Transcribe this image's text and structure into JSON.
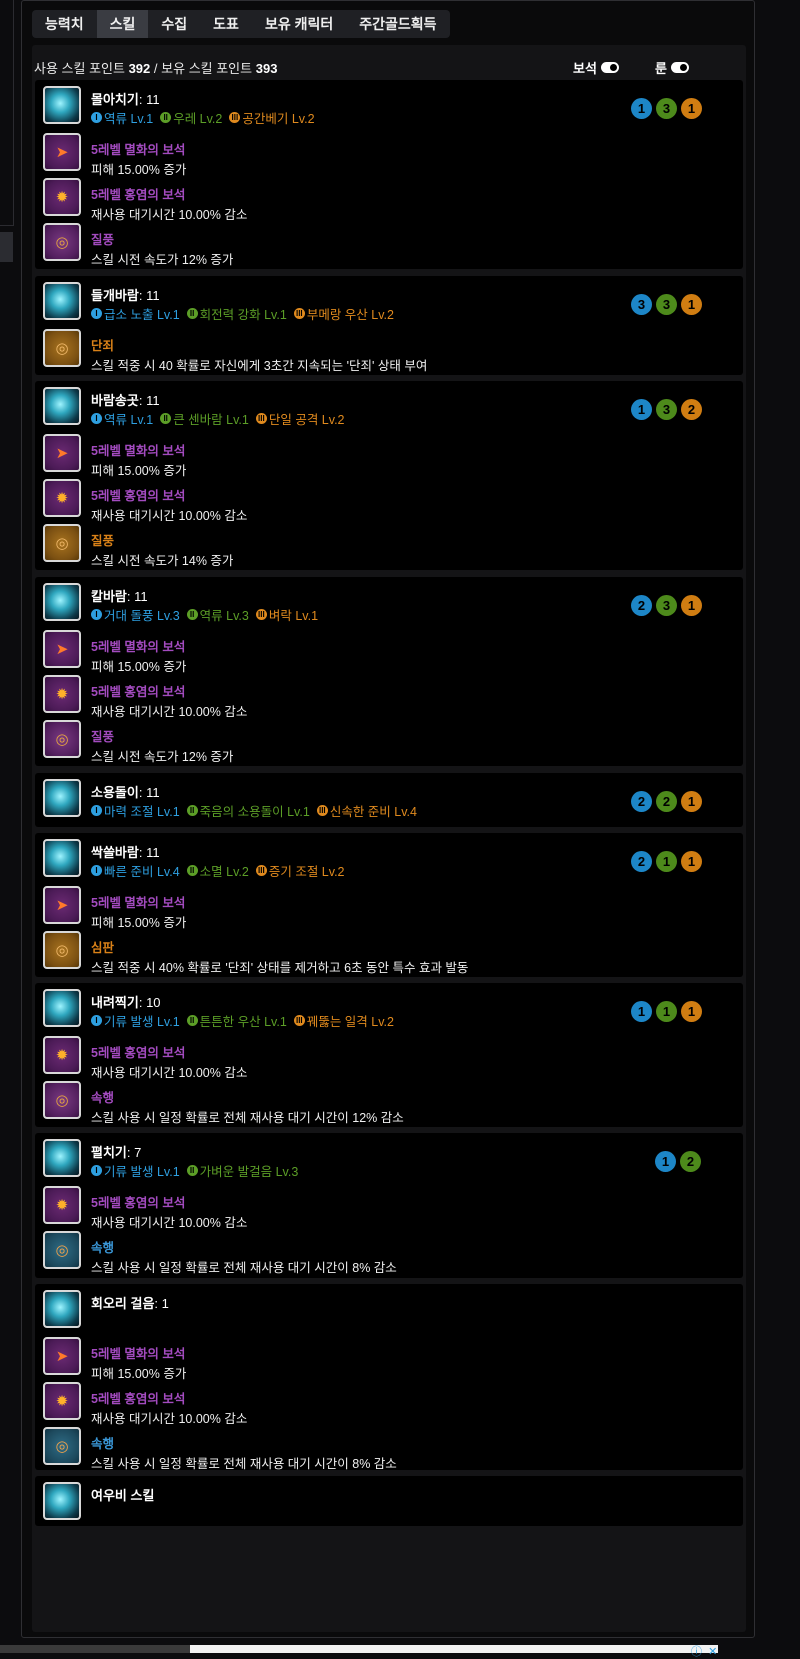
{
  "tabs": [
    "능력치",
    "스킬",
    "수집",
    "도표",
    "보유 캐릭터",
    "주간골드획득"
  ],
  "active_tab": 1,
  "points": {
    "used_label": "사용 스킬 포인트",
    "used": "392",
    "sep": "/",
    "owned_label": "보유 스킬 포인트",
    "owned": "393"
  },
  "toggles": {
    "gem": "보석",
    "rune": "룬"
  },
  "skills": [
    {
      "name": "몰아치기",
      "level": ": 11",
      "tripods": [
        {
          "tier": "I",
          "label": "역류 Lv.1"
        },
        {
          "tier": "II",
          "label": "우레 Lv.2"
        },
        {
          "tier": "III",
          "label": "공간베기 Lv.2"
        }
      ],
      "circles": [
        "1",
        "3",
        "1"
      ],
      "items": [
        {
          "title": "5레벨 멸화의 보석",
          "desc": "피해 15.00% 증가",
          "color": "purple",
          "icon": "gem-red"
        },
        {
          "title": "5레벨 홍염의 보석",
          "desc": "재사용 대기시간 10.00% 감소",
          "color": "purple",
          "icon": "gem-org"
        },
        {
          "title": "질풍",
          "desc": "스킬 시전 속도가 12% 증가",
          "color": "purple",
          "icon": "rune-purple"
        }
      ]
    },
    {
      "name": "들개바람",
      "level": ": 11",
      "tripods": [
        {
          "tier": "I",
          "label": "급소 노출 Lv.1"
        },
        {
          "tier": "II",
          "label": "회전력 강화 Lv.1"
        },
        {
          "tier": "III",
          "label": "부메랑 우산 Lv.2"
        }
      ],
      "circles": [
        "3",
        "3",
        "1"
      ],
      "items": [
        {
          "title": "단죄",
          "desc": "스킬 적중 시 40 확률로 자신에게 3초간 지속되는 '단죄' 상태 부여",
          "color": "orange",
          "icon": "rune-orange"
        }
      ]
    },
    {
      "name": "바람송곳",
      "level": ": 11",
      "tripods": [
        {
          "tier": "I",
          "label": "역류 Lv.1"
        },
        {
          "tier": "II",
          "label": "큰 센바람 Lv.1"
        },
        {
          "tier": "III",
          "label": "단일 공격 Lv.2"
        }
      ],
      "circles": [
        "1",
        "3",
        "2"
      ],
      "items": [
        {
          "title": "5레벨 멸화의 보석",
          "desc": "피해 15.00% 증가",
          "color": "purple",
          "icon": "gem-red"
        },
        {
          "title": "5레벨 홍염의 보석",
          "desc": "재사용 대기시간 10.00% 감소",
          "color": "purple",
          "icon": "gem-org"
        },
        {
          "title": "질풍",
          "desc": "스킬 시전 속도가 14% 증가",
          "color": "orange",
          "icon": "rune-orange"
        }
      ]
    },
    {
      "name": "칼바람",
      "level": ": 11",
      "tripods": [
        {
          "tier": "I",
          "label": "거대 돌풍 Lv.3"
        },
        {
          "tier": "II",
          "label": "역류 Lv.3"
        },
        {
          "tier": "III",
          "label": "벼락 Lv.1"
        }
      ],
      "circles": [
        "2",
        "3",
        "1"
      ],
      "items": [
        {
          "title": "5레벨 멸화의 보석",
          "desc": "피해 15.00% 증가",
          "color": "purple",
          "icon": "gem-red"
        },
        {
          "title": "5레벨 홍염의 보석",
          "desc": "재사용 대기시간 10.00% 감소",
          "color": "purple",
          "icon": "gem-org"
        },
        {
          "title": "질풍",
          "desc": "스킬 시전 속도가 12% 증가",
          "color": "purple",
          "icon": "rune-purple"
        }
      ]
    },
    {
      "name": "소용돌이",
      "level": ": 11",
      "tripods": [
        {
          "tier": "I",
          "label": "마력 조절 Lv.1"
        },
        {
          "tier": "II",
          "label": "죽음의 소용돌이 Lv.1"
        },
        {
          "tier": "III",
          "label": "신속한 준비 Lv.4"
        }
      ],
      "circles": [
        "2",
        "2",
        "1"
      ],
      "items": []
    },
    {
      "name": "싹쓸바람",
      "level": ": 11",
      "tripods": [
        {
          "tier": "I",
          "label": "빠른 준비 Lv.4"
        },
        {
          "tier": "II",
          "label": "소멸 Lv.2"
        },
        {
          "tier": "III",
          "label": "증기 조절 Lv.2"
        }
      ],
      "circles": [
        "2",
        "1",
        "1"
      ],
      "items": [
        {
          "title": "5레벨 멸화의 보석",
          "desc": "피해 15.00% 증가",
          "color": "purple",
          "icon": "gem-red"
        },
        {
          "title": "심판",
          "desc": "스킬 적중 시 40% 확률로 '단죄' 상태를 제거하고 6초 동안 특수 효과 발동",
          "color": "orange",
          "icon": "rune-orange"
        }
      ]
    },
    {
      "name": "내려찍기",
      "level": ": 10",
      "tripods": [
        {
          "tier": "I",
          "label": "기류 발생 Lv.1"
        },
        {
          "tier": "II",
          "label": "튼튼한 우산 Lv.1"
        },
        {
          "tier": "III",
          "label": "꿰뚫는 일격 Lv.2"
        }
      ],
      "circles": [
        "1",
        "1",
        "1"
      ],
      "items": [
        {
          "title": "5레벨 홍염의 보석",
          "desc": "재사용 대기시간 10.00% 감소",
          "color": "purple",
          "icon": "gem-org"
        },
        {
          "title": "속행",
          "desc": "스킬 사용 시 일정 확률로 전체 재사용 대기 시간이 12% 감소",
          "color": "purple",
          "icon": "rune-purple"
        }
      ]
    },
    {
      "name": "펼치기",
      "level": ": 7",
      "tripods": [
        {
          "tier": "I",
          "label": "기류 발생 Lv.1"
        },
        {
          "tier": "II",
          "label": "가벼운 발걸음 Lv.3"
        }
      ],
      "circles": [
        "1",
        "2"
      ],
      "items": [
        {
          "title": "5레벨 홍염의 보석",
          "desc": "재사용 대기시간 10.00% 감소",
          "color": "purple",
          "icon": "gem-org"
        },
        {
          "title": "속행",
          "desc": "스킬 사용 시 일정 확률로 전체 재사용 대기 시간이 8% 감소",
          "color": "blue",
          "icon": "rune-blue"
        }
      ]
    },
    {
      "name": "회오리 걸음",
      "level": ": 1",
      "tripods": [],
      "circles": [],
      "items": [
        {
          "title": "5레벨 멸화의 보석",
          "desc": "피해 15.00% 증가",
          "color": "purple",
          "icon": "gem-red"
        },
        {
          "title": "5레벨 홍염의 보석",
          "desc": "재사용 대기시간 10.00% 감소",
          "color": "purple",
          "icon": "gem-org"
        },
        {
          "title": "속행",
          "desc": "스킬 사용 시 일정 확률로 전체 재사용 대기 시간이 8% 감소",
          "color": "blue",
          "icon": "rune-blue"
        }
      ]
    },
    {
      "name": "여우비 스킬",
      "level": "",
      "tripods": [],
      "circles": [],
      "items": []
    }
  ],
  "colors": {
    "tier1": "#2e9fe0",
    "tier2": "#5c9e27",
    "tier3": "#e08a1e",
    "gem": "#a34bbf",
    "rune_orange": "#d98118",
    "rune_blue": "#3a96d6"
  },
  "ad": {
    "info_icon": "info-icon",
    "close_icon": "close-icon"
  }
}
